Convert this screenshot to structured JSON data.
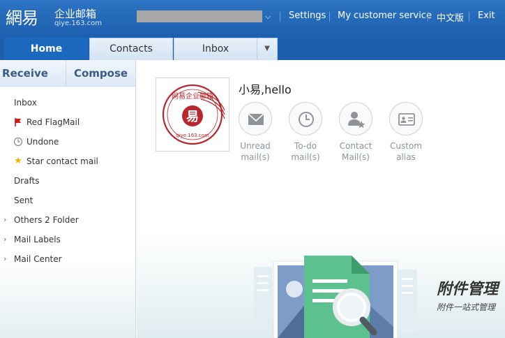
{
  "brand": {
    "logo_big": "網易",
    "logo_cn": "企业邮箱",
    "logo_domain": "qiye.163.com"
  },
  "topnav": {
    "settings": "Settings",
    "customer_service": "My customer service",
    "language": "中文版",
    "exit": "Exit"
  },
  "tabs": [
    {
      "label": "Home",
      "active": true
    },
    {
      "label": "Contacts",
      "active": false
    },
    {
      "label": "Inbox",
      "active": false
    }
  ],
  "sidebar": {
    "receive": "Receive",
    "compose": "Compose",
    "items": [
      {
        "label": "Inbox",
        "icon": ""
      },
      {
        "label": "Red FlagMail",
        "icon": "red-flag-icon"
      },
      {
        "label": "Undone",
        "icon": "clock-icon"
      },
      {
        "label": "Star contact mail",
        "icon": "star-icon"
      },
      {
        "label": "Drafts",
        "icon": ""
      },
      {
        "label": "Sent",
        "icon": ""
      },
      {
        "label": "Others 2 Folder",
        "icon": "chevron-right-icon"
      },
      {
        "label": "Mail Labels",
        "icon": "chevron-right-icon"
      },
      {
        "label": "Mail Center",
        "icon": "chevron-right-icon"
      }
    ]
  },
  "main": {
    "greeting": "小易,hello",
    "avatar_stamp": {
      "text_top": "网易企业邮箱",
      "text_bottom": "qiye.163.com"
    },
    "quick_actions": [
      {
        "line1": "Unread",
        "line2": "mail(s)",
        "icon": "envelope-icon"
      },
      {
        "line1": "To-do",
        "line2": "mail(s)",
        "icon": "clock-icon"
      },
      {
        "line1": "Contact",
        "line2": "Mail(s)",
        "icon": "contact-star-icon"
      },
      {
        "line1": "Custom",
        "line2": "alias",
        "icon": "id-card-icon"
      }
    ],
    "promo": {
      "title": "附件管理",
      "subtitle": "附件一站式管理"
    }
  },
  "colors": {
    "header_blue": "#1c5fae",
    "tab_active": "#1b68bd",
    "sidebar_text": "#3b5b86"
  }
}
